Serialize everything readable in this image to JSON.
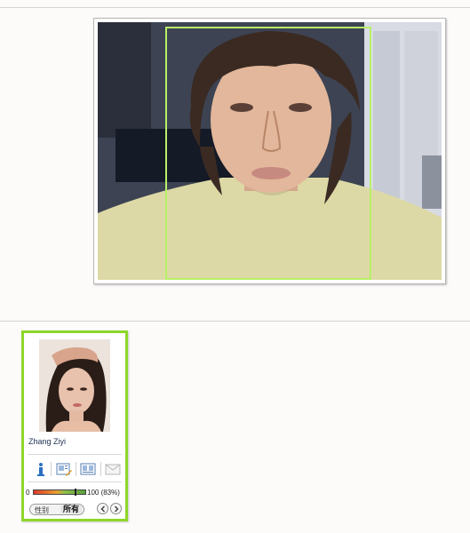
{
  "result": {
    "person_name": "Zhang Ziyi",
    "score": {
      "min_label": "0",
      "max_label": "100 (83%)",
      "fraction": 0.83
    },
    "gender_filter": {
      "label": "性别",
      "value": "所有"
    },
    "icons": [
      "info-icon",
      "edit-photo-icon",
      "compare-profile-icon",
      "mail-icon"
    ]
  },
  "colors": {
    "face_box": "#b9ef68",
    "card_border": "#8dd62a",
    "info_icon": "#2b6fc0"
  }
}
